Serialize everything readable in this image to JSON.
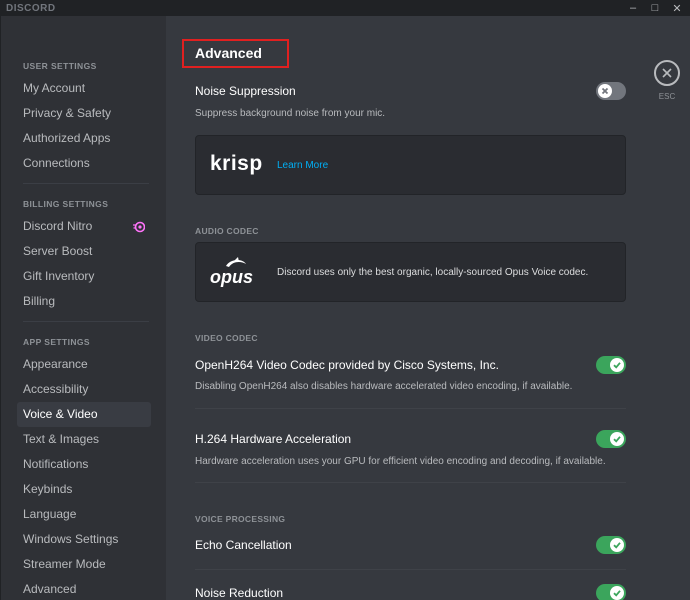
{
  "app_title": "DISCORD",
  "window_controls": [
    "minimize",
    "maximize",
    "close"
  ],
  "sidebar": {
    "sections": [
      {
        "header": "USER SETTINGS",
        "items": [
          {
            "label": "My Account"
          },
          {
            "label": "Privacy & Safety"
          },
          {
            "label": "Authorized Apps"
          },
          {
            "label": "Connections"
          }
        ]
      },
      {
        "header": "BILLING SETTINGS",
        "items": [
          {
            "label": "Discord Nitro",
            "icon": "nitro-icon"
          },
          {
            "label": "Server Boost"
          },
          {
            "label": "Gift Inventory"
          },
          {
            "label": "Billing"
          }
        ]
      },
      {
        "header": "APP SETTINGS",
        "items": [
          {
            "label": "Appearance"
          },
          {
            "label": "Accessibility"
          },
          {
            "label": "Voice & Video",
            "selected": true
          },
          {
            "label": "Text & Images"
          },
          {
            "label": "Notifications"
          },
          {
            "label": "Keybinds"
          },
          {
            "label": "Language"
          },
          {
            "label": "Windows Settings"
          },
          {
            "label": "Streamer Mode"
          },
          {
            "label": "Advanced"
          }
        ]
      }
    ]
  },
  "main": {
    "title": "Advanced",
    "close_label": "ESC",
    "noise_suppression": {
      "title": "Noise Suppression",
      "description": "Suppress background noise from your mic.",
      "enabled": false,
      "krisp_logo": "krisp",
      "learn_more": "Learn More"
    },
    "audio_codec": {
      "label": "AUDIO CODEC",
      "logo": "opus",
      "text": "Discord uses only the best organic, locally-sourced Opus Voice codec."
    },
    "video_codec": {
      "label": "VIDEO CODEC",
      "openh264": {
        "title": "OpenH264 Video Codec provided by Cisco Systems, Inc.",
        "description": "Disabling OpenH264 also disables hardware accelerated video encoding, if available.",
        "enabled": true
      },
      "h264": {
        "title": "H.264 Hardware Acceleration",
        "description": "Hardware acceleration uses your GPU for efficient video encoding and decoding, if available.",
        "enabled": true
      }
    },
    "voice_processing": {
      "label": "VOICE PROCESSING",
      "echo_cancellation": {
        "title": "Echo Cancellation",
        "enabled": true
      },
      "noise_reduction": {
        "title": "Noise Reduction",
        "enabled": true
      }
    }
  },
  "colors": {
    "accent_green": "#3ba55c",
    "toggle_off": "#72767d",
    "link": "#00aff4",
    "highlight_box": "#e02020",
    "nitro": "#ff73fa"
  }
}
